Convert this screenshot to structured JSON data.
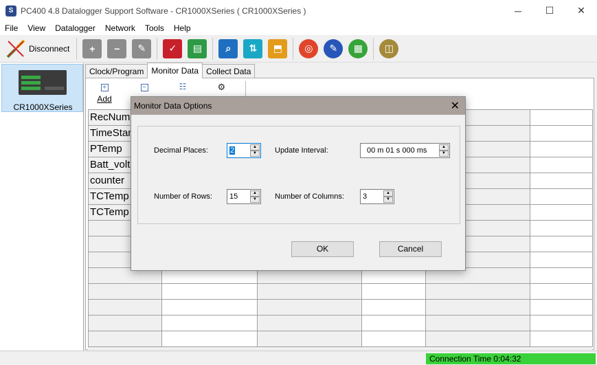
{
  "window": {
    "title": "PC400 4.8 Datalogger Support Software - CR1000XSeries ( CR1000XSeries )",
    "minimize": "─",
    "maximize": "☐",
    "close": "✕"
  },
  "menu": [
    "File",
    "View",
    "Datalogger",
    "Network",
    "Tools",
    "Help"
  ],
  "toolbar": {
    "disconnect_label": "Disconnect"
  },
  "station": {
    "name": "CR1000XSeries"
  },
  "tabs": [
    "Clock/Program",
    "Monitor Data",
    "Collect Data"
  ],
  "monitor_toolbar": {
    "add_label": "Add"
  },
  "grid": {
    "rows": [
      "RecNum",
      "TimeStamp",
      "PTemp",
      "Batt_volt",
      "counter",
      "TCTemp",
      "TCTemp"
    ]
  },
  "status": {
    "connection_time": "Connection Time 0:04:32"
  },
  "dialog": {
    "title": "Monitor Data Options",
    "close": "✕",
    "decimal_places_label": "Decimal Places:",
    "decimal_places_value": "2",
    "update_interval_label": "Update Interval:",
    "update_interval_value": "00 m 01 s 000 ms",
    "rows_label": "Number of Rows:",
    "rows_value": "15",
    "columns_label": "Number of Columns:",
    "columns_value": "3",
    "ok_label": "OK",
    "cancel_label": "Cancel"
  }
}
